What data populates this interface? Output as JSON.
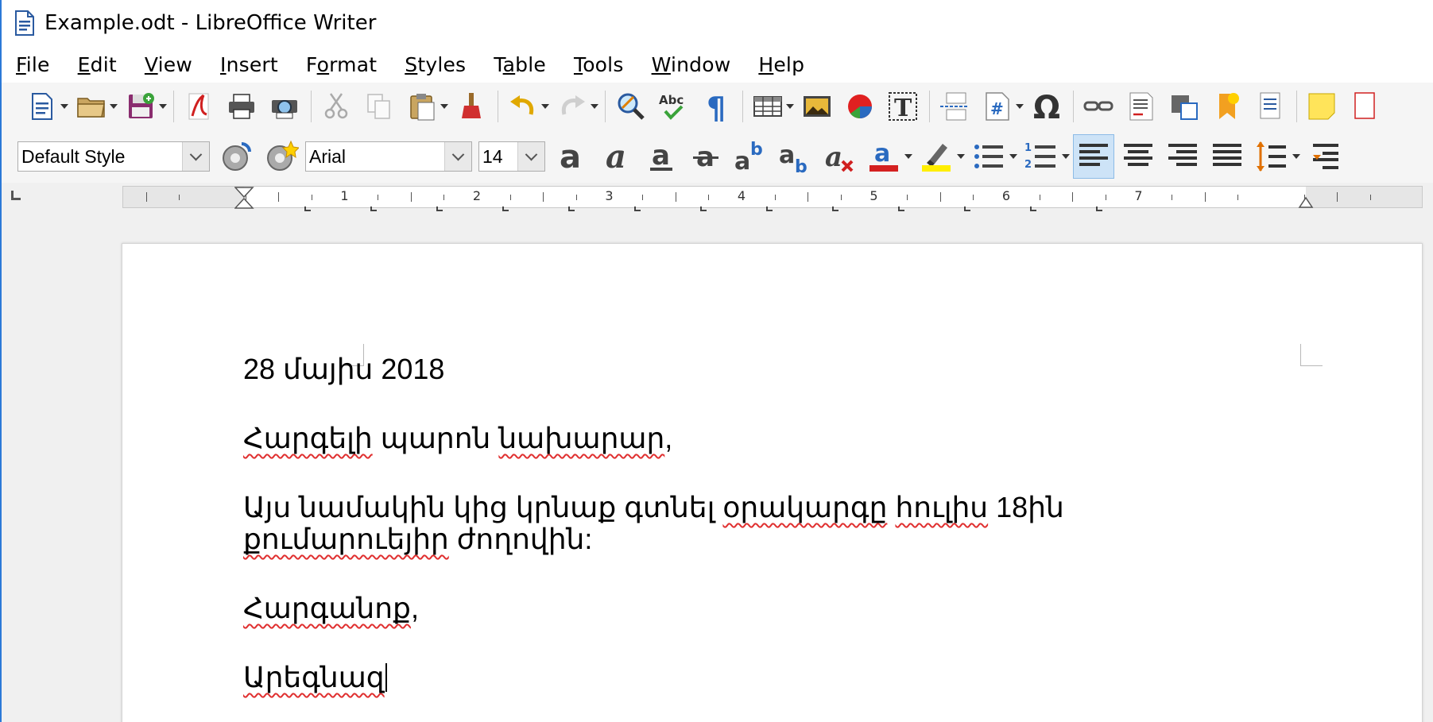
{
  "window": {
    "title": "Example.odt - LibreOffice Writer"
  },
  "menubar": {
    "items": [
      {
        "label": "File",
        "accel": "F"
      },
      {
        "label": "Edit",
        "accel": "E"
      },
      {
        "label": "View",
        "accel": "V"
      },
      {
        "label": "Insert",
        "accel": "I"
      },
      {
        "label": "Format",
        "accel": "o"
      },
      {
        "label": "Styles",
        "accel": "S"
      },
      {
        "label": "Table",
        "accel": "a"
      },
      {
        "label": "Tools",
        "accel": "T"
      },
      {
        "label": "Window",
        "accel": "W"
      },
      {
        "label": "Help",
        "accel": "H"
      }
    ]
  },
  "formatting": {
    "paragraph_style": "Default Style",
    "font_name": "Arial",
    "font_size": "14"
  },
  "ruler": {
    "numbers": [
      "1",
      "2",
      "3",
      "4",
      "5",
      "6",
      "7"
    ]
  },
  "document": {
    "paragraphs": [
      {
        "segments": [
          {
            "text": "28 մայիս 2018",
            "misspelled": false
          }
        ]
      },
      {
        "segments": [
          {
            "text": "Հարգելի",
            "misspelled": true
          },
          {
            "text": " պարոն ",
            "misspelled": false
          },
          {
            "text": "նախարար",
            "misspelled": true
          },
          {
            "text": ",",
            "misspelled": false
          }
        ]
      },
      {
        "segments": [
          {
            "text": "Այս նամակին կից կրնաք գտնել ",
            "misspelled": false
          },
          {
            "text": "օրակարգը",
            "misspelled": true
          },
          {
            "text": " ",
            "misspelled": false
          },
          {
            "text": "հուլիս",
            "misspelled": true
          },
          {
            "text": " 18ին ",
            "misspelled": false
          },
          {
            "text": "քումարուեյիր",
            "misspelled": true
          },
          {
            "text": " ժողովին:",
            "misspelled": false
          }
        ]
      },
      {
        "segments": [
          {
            "text": "Հարգանոք",
            "misspelled": true
          },
          {
            "text": ",",
            "misspelled": false
          }
        ]
      },
      {
        "segments": [
          {
            "text": "Արեգնազ",
            "misspelled": true
          }
        ],
        "cursor": true
      }
    ]
  },
  "colors": {
    "accent": "#2b79d7",
    "spellcheck": "#e03030",
    "font_color_bar": "#d42020",
    "highlight_bar": "#ffee00"
  }
}
